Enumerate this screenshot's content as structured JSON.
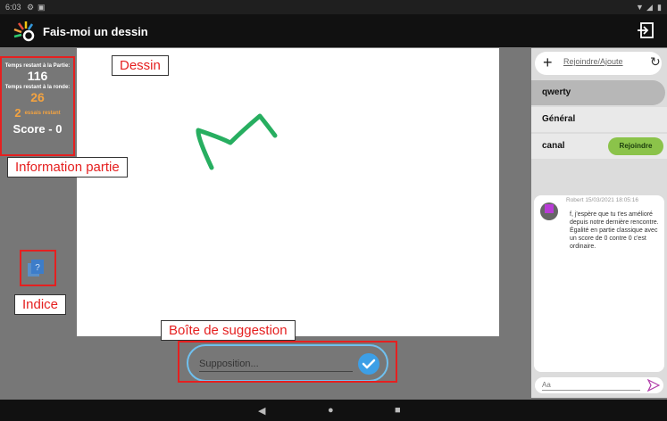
{
  "status_bar": {
    "time": "6:03"
  },
  "app_bar": {
    "title": "Fais-moi un dessin"
  },
  "game_info": {
    "time_left_game_label": "Temps restant à la Partie:",
    "time_left_game_value": "116",
    "time_left_round_label": "Temps restant à la ronde:",
    "time_left_round_value": "26",
    "tries_count": "2",
    "tries_label": "essais restant",
    "score": "Score - 0"
  },
  "chat_panel": {
    "channel_search_placeholder": "Rejoindre/Ajoute",
    "channels": [
      {
        "name": "qwerty",
        "active": true
      },
      {
        "name": "Général",
        "active": false
      },
      {
        "name": "canal",
        "active": false,
        "join_label": "Rejoindre"
      }
    ],
    "message": {
      "meta": "Robert 15/03/2021 18:05:16",
      "text": "f, j'espère que tu t'es amélioré depuis notre dernière rencontre. Égalité en partie classique avec un score de 0 contre 0 c'est ordinaire."
    },
    "input_placeholder": "Aa"
  },
  "guess_box": {
    "placeholder": "Supposition..."
  },
  "annotations": {
    "dessin": "Dessin",
    "info": "Information partie",
    "indice": "Indice",
    "suggestion": "Boîte de suggestion"
  },
  "colors": {
    "accent": "#3d9fe6",
    "join": "#8bc34a",
    "annotation": "#e52020",
    "drawing_stroke": "#27ae60"
  }
}
